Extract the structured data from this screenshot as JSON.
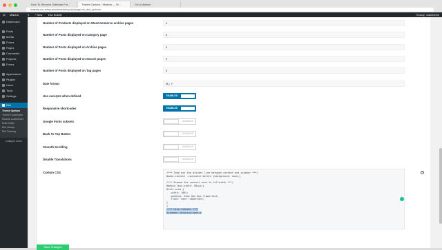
{
  "browser": {
    "tabs": [
      "How To Remove Sidebars Fro...",
      "Theme Options ‹ Makeia — W...",
      "Divi | Makeia"
    ],
    "address": "makeia.co.uk/wp-admin/admin.php?page=et_divi_options",
    "colors": {
      "close": "#ff5f57",
      "min": "#febc2e",
      "max": "#28c840"
    }
  },
  "adminbar": {
    "site": "Makeia",
    "comments": "0",
    "new": "+ New",
    "theme_builder": "Divi Builder",
    "user": "Howdy, makeiamin"
  },
  "sidebar": {
    "items": [
      {
        "label": "Dashboard",
        "icon": "dashboard-icon"
      },
      {
        "label": "Posts",
        "icon": "pin-icon"
      },
      {
        "label": "Media",
        "icon": "media-icon"
      },
      {
        "label": "Forms",
        "icon": "forms-icon"
      },
      {
        "label": "Pages",
        "icon": "pages-icon"
      },
      {
        "label": "Comments",
        "icon": "comment-icon"
      },
      {
        "label": "Projects",
        "icon": "projects-icon"
      },
      {
        "label": "Forms",
        "icon": "forms-icon"
      },
      {
        "label": "Appearance",
        "icon": "brush-icon"
      },
      {
        "label": "Plugins",
        "icon": "plugin-icon"
      },
      {
        "label": "Users",
        "icon": "users-icon"
      },
      {
        "label": "Tools",
        "icon": "tools-icon"
      },
      {
        "label": "Settings",
        "icon": "settings-icon"
      },
      {
        "label": "Divi",
        "icon": "divi-icon"
      }
    ],
    "submenu": [
      "Theme Options",
      "Theme Customizer",
      "Module Customizer",
      "Role Editor",
      "Divi Library",
      "Divi Training"
    ],
    "collapse": "Collapse menu"
  },
  "options": {
    "rows": [
      {
        "label": "Number of Products displayed on WooCommerce archive pages",
        "value": "9"
      },
      {
        "label": "Number of Posts displayed on Category page",
        "value": "6"
      },
      {
        "label": "Number of Posts displayed on Archive pages",
        "value": "5"
      },
      {
        "label": "Number of Posts displayed on Search pages",
        "value": "5"
      },
      {
        "label": "Number of Posts displayed on Tag pages",
        "value": "5"
      },
      {
        "label": "Date format",
        "value": "M j, Y"
      }
    ],
    "toggles": [
      {
        "label": "Use excerpts when defined",
        "state": "ENABLED"
      },
      {
        "label": "Responsive shortcodes",
        "state": "ENABLED"
      },
      {
        "label": "Google Fonts subsets",
        "state": "DISABLED"
      },
      {
        "label": "Back To Top Button",
        "state": "DISABLED"
      },
      {
        "label": "Smooth Scrolling",
        "state": "DISABLED"
      },
      {
        "label": "Disable Translations",
        "state": "DISABLED"
      }
    ],
    "enabled_label": "ENABLED",
    "disabled_label": "DISABLED",
    "custom_css_label": "Custom CSS",
    "custom_css_text": "/*** Take out the divider line between content and sidebar ***/\n#main-content .container:before {background: none;}\n\n/*** Expand the content area to fullwidth ***/\n@media (min-width: 981px){\n#left-area {\n   width: 100%;\n   padding: 23px 0px 0px !important;\n   float: none !important;\n}\n}\n",
    "custom_css_selected": "/*** Hide Sidebar ***/\n#sidebar {display:none;}",
    "save_label": "Save Changes",
    "help_icon": "?"
  }
}
